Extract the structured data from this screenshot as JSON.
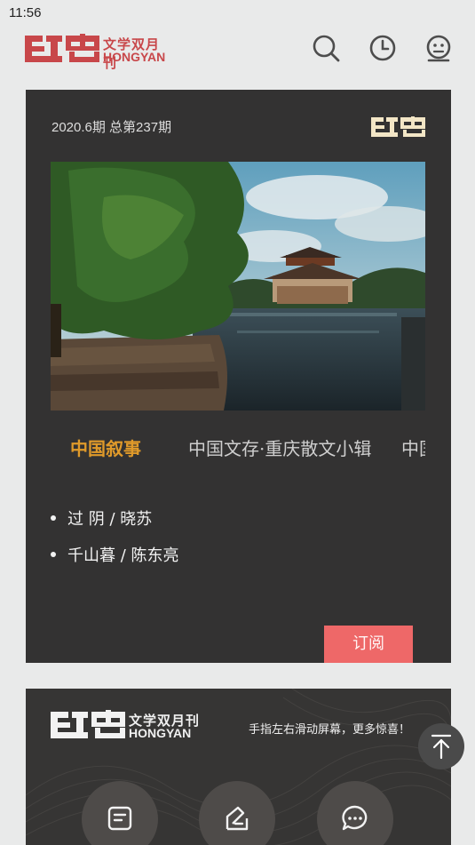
{
  "status_bar": {
    "time": "11:56"
  },
  "header": {
    "logo_mark": "红岩",
    "logo_subtitle_cn": "文学双月刊",
    "logo_subtitle_en": "HONGYAN",
    "icons": [
      "search-icon",
      "history-clock-icon",
      "profile-face-icon"
    ]
  },
  "issue_card": {
    "issue_label": "2020.6期 总第237期",
    "logo_mark": "红岩",
    "tabs": [
      {
        "label": "中国叙事",
        "active": true
      },
      {
        "label": "中国文存·重庆散文小辑",
        "active": false
      },
      {
        "label": "中国",
        "active": false
      }
    ],
    "articles": [
      {
        "label": "过 阴 / 晓苏"
      },
      {
        "label": "千山暮 / 陈东亮"
      }
    ],
    "subscribe_label": "订阅"
  },
  "bottom_card": {
    "logo_mark": "红岩",
    "logo_subtitle_cn": "文学双月刊",
    "logo_subtitle_en": "HONGYAN",
    "swipe_hint": "手指左右滑动屏幕，更多惊喜！",
    "buttons": [
      "document-icon",
      "write-icon",
      "chat-icon"
    ]
  },
  "colors": {
    "brand_red": "#c8474a",
    "card_bg": "#333232",
    "active_tab": "#e09a2a",
    "subscribe_bg": "#ee6868"
  }
}
